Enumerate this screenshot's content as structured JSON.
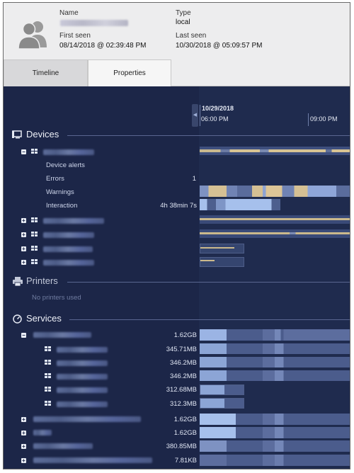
{
  "header": {
    "name_label": "Name",
    "type_label": "Type",
    "type_value": "local",
    "first_seen_label": "First seen",
    "first_seen_value": "08/14/2018 @ 02:39:48 PM",
    "last_seen_label": "Last seen",
    "last_seen_value": "10/30/2018 @ 05:09:57 PM",
    "avatar_icon": "users-icon"
  },
  "tabs": [
    {
      "label": "Timeline",
      "active": false
    },
    {
      "label": "Properties",
      "active": true
    }
  ],
  "timeline": {
    "date": "10/29/2018",
    "times": [
      "06:00 PM",
      "09:00 PM"
    ]
  },
  "devices": {
    "title": "Devices",
    "icon": "monitor-icon",
    "expanded_device": {
      "metrics": [
        {
          "label": "Device alerts",
          "value": ""
        },
        {
          "label": "Errors",
          "value": "1"
        },
        {
          "label": "Warnings",
          "value": ""
        },
        {
          "label": "Interaction",
          "value": "4h 38min 7s"
        }
      ]
    }
  },
  "printers": {
    "title": "Printers",
    "icon": "printer-icon",
    "empty_text": "No printers used"
  },
  "services": {
    "title": "Services",
    "icon": "gauge-icon",
    "parent_value": "1.62GB",
    "children_values": [
      "345.71MB",
      "346.2MB",
      "346.2MB",
      "312.68MB",
      "312.3MB"
    ],
    "other_values": [
      "1.62GB",
      "1.62GB",
      "380.85MB",
      "7.81KB"
    ]
  },
  "colors": {
    "background": "#1c2648",
    "bar_light": "#9db6e2",
    "bar_tan": "#d8c493",
    "bar_mid": "#4d5f8e"
  }
}
